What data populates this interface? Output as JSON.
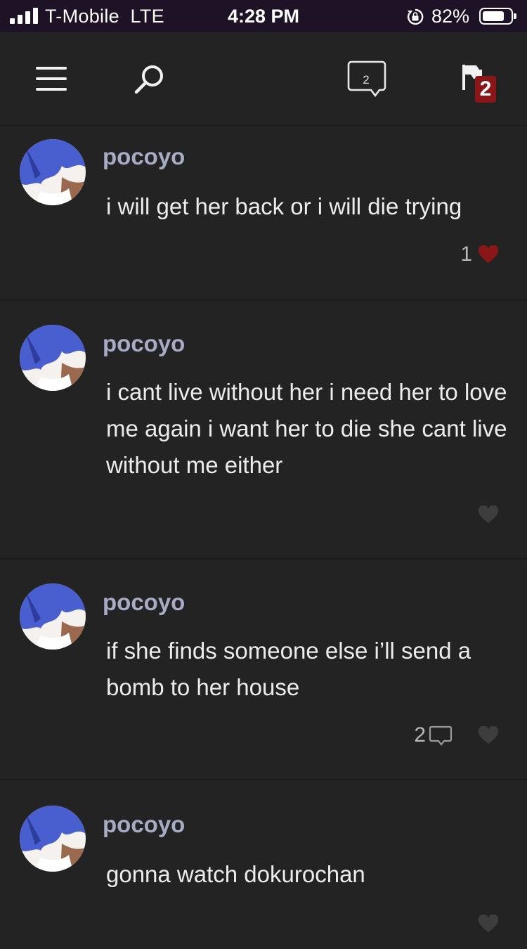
{
  "status_bar": {
    "carrier": "T-Mobile",
    "network": "LTE",
    "time": "4:28 PM",
    "battery": "82%",
    "battery_level": 0.82,
    "icons": [
      "signal-icon",
      "rotation-lock-icon",
      "battery-icon"
    ]
  },
  "nav": {
    "icons": [
      "menu-icon",
      "search-icon",
      "messages-icon",
      "flag-icon"
    ],
    "message_count": "2",
    "notification_count": "2",
    "badge_color": "#8b1618"
  },
  "colors": {
    "background": "#232323",
    "username": "#a7acc4",
    "heart_liked": "#8b1618",
    "heart_default": "#3d3d3d"
  },
  "posts": [
    {
      "username": "pocoyo",
      "text": "i will get her back or i will die trying",
      "likes": "1",
      "liked": true,
      "comments": ""
    },
    {
      "username": "pocoyo",
      "text": "i cant live without her i need her to love me again i want her to die she cant live without me either",
      "likes": "",
      "liked": false,
      "comments": ""
    },
    {
      "username": "pocoyo",
      "text": "if she finds someone else i’ll send a bomb to her house",
      "likes": "",
      "liked": false,
      "comments": "2"
    },
    {
      "username": "pocoyo",
      "text": "gonna watch dokurochan",
      "likes": "",
      "liked": false,
      "comments": ""
    }
  ]
}
